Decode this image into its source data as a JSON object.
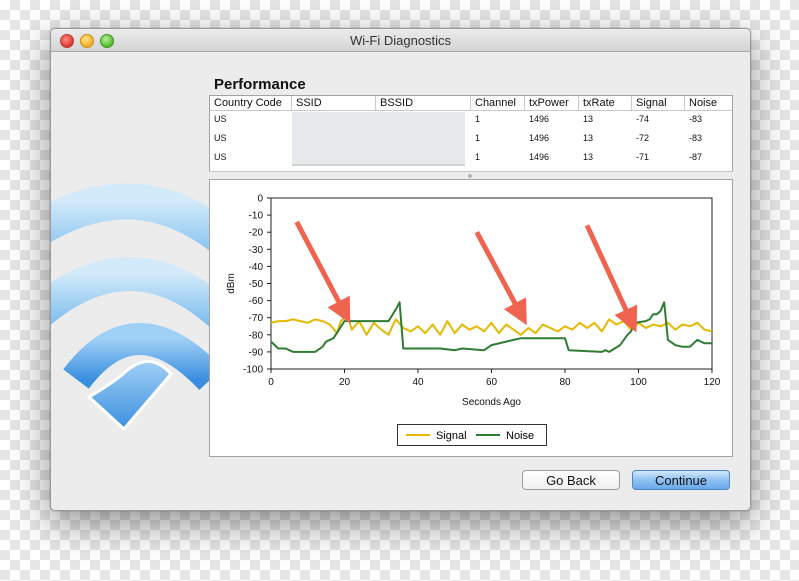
{
  "window": {
    "title": "Wi-Fi Diagnostics"
  },
  "performance": {
    "heading": "Performance",
    "columns": [
      "Country Code",
      "SSID",
      "BSSID",
      "Channel",
      "txPower",
      "txRate",
      "Signal",
      "Noise"
    ],
    "rows": [
      {
        "country": "US",
        "channel": "1",
        "txpower": "1496",
        "txrate": "13",
        "signal": "-74",
        "noise": "-83"
      },
      {
        "country": "US",
        "channel": "1",
        "txpower": "1496",
        "txrate": "13",
        "signal": "-72",
        "noise": "-83"
      },
      {
        "country": "US",
        "channel": "1",
        "txpower": "1496",
        "txrate": "13",
        "signal": "-71",
        "noise": "-87"
      }
    ]
  },
  "chart_data": {
    "type": "line",
    "xlabel": "Seconds Ago",
    "ylabel": "dBm",
    "xlim": [
      0,
      120
    ],
    "ylim": [
      -100,
      0
    ],
    "xticks": [
      0,
      20,
      40,
      60,
      80,
      100,
      120
    ],
    "yticks": [
      0,
      -10,
      -20,
      -30,
      -40,
      -50,
      -60,
      -70,
      -80,
      -90,
      -100
    ],
    "legend_position": "bottom-center",
    "series": [
      {
        "name": "Signal",
        "color": "#e6b800",
        "points": [
          [
            0,
            -73
          ],
          [
            2,
            -72
          ],
          [
            4,
            -72
          ],
          [
            6,
            -71
          ],
          [
            8,
            -72
          ],
          [
            10,
            -73
          ],
          [
            12,
            -71
          ],
          [
            14,
            -72
          ],
          [
            16,
            -74
          ],
          [
            18,
            -79
          ],
          [
            19,
            -72
          ],
          [
            20,
            -70
          ],
          [
            21,
            -70
          ],
          [
            22,
            -77
          ],
          [
            24,
            -72
          ],
          [
            26,
            -80
          ],
          [
            28,
            -73
          ],
          [
            30,
            -77
          ],
          [
            32,
            -80
          ],
          [
            33,
            -75
          ],
          [
            34,
            -71
          ],
          [
            36,
            -76
          ],
          [
            38,
            -78
          ],
          [
            40,
            -75
          ],
          [
            42,
            -79
          ],
          [
            44,
            -74
          ],
          [
            46,
            -80
          ],
          [
            48,
            -72
          ],
          [
            50,
            -79
          ],
          [
            52,
            -74
          ],
          [
            54,
            -77
          ],
          [
            56,
            -75
          ],
          [
            58,
            -78
          ],
          [
            60,
            -73
          ],
          [
            62,
            -79
          ],
          [
            64,
            -74
          ],
          [
            66,
            -77
          ],
          [
            68,
            -80
          ],
          [
            70,
            -76
          ],
          [
            72,
            -79
          ],
          [
            74,
            -74
          ],
          [
            76,
            -76
          ],
          [
            78,
            -78
          ],
          [
            80,
            -75
          ],
          [
            82,
            -77
          ],
          [
            84,
            -73
          ],
          [
            86,
            -76
          ],
          [
            88,
            -73
          ],
          [
            90,
            -78
          ],
          [
            92,
            -71
          ],
          [
            94,
            -74
          ],
          [
            96,
            -72
          ],
          [
            98,
            -77
          ],
          [
            100,
            -73
          ],
          [
            102,
            -76
          ],
          [
            104,
            -74
          ],
          [
            106,
            -75
          ],
          [
            108,
            -73
          ],
          [
            110,
            -77
          ],
          [
            112,
            -74
          ],
          [
            114,
            -75
          ],
          [
            116,
            -73
          ],
          [
            118,
            -77
          ],
          [
            120,
            -78
          ]
        ]
      },
      {
        "name": "Noise",
        "color": "#2e7d32",
        "points": [
          [
            0,
            -84
          ],
          [
            2,
            -88
          ],
          [
            4,
            -88
          ],
          [
            6,
            -90
          ],
          [
            8,
            -90
          ],
          [
            10,
            -90
          ],
          [
            12,
            -90
          ],
          [
            14,
            -87
          ],
          [
            15,
            -84
          ],
          [
            17,
            -82
          ],
          [
            20,
            -72
          ],
          [
            30,
            -72
          ],
          [
            32,
            -72
          ],
          [
            34,
            -65
          ],
          [
            35,
            -61
          ],
          [
            36,
            -88
          ],
          [
            40,
            -88
          ],
          [
            46,
            -88
          ],
          [
            50,
            -89
          ],
          [
            52,
            -88
          ],
          [
            58,
            -89
          ],
          [
            60,
            -86
          ],
          [
            64,
            -84
          ],
          [
            68,
            -82
          ],
          [
            80,
            -82
          ],
          [
            81,
            -89
          ],
          [
            90,
            -90
          ],
          [
            91,
            -89
          ],
          [
            92,
            -90
          ],
          [
            95,
            -86
          ],
          [
            97,
            -80
          ],
          [
            98,
            -78
          ],
          [
            99,
            -73
          ],
          [
            102,
            -72
          ],
          [
            103,
            -71
          ],
          [
            104,
            -68
          ],
          [
            105,
            -68
          ],
          [
            106,
            -66
          ],
          [
            107,
            -61
          ],
          [
            108,
            -83
          ],
          [
            110,
            -86
          ],
          [
            112,
            -87
          ],
          [
            114,
            -87
          ],
          [
            116,
            -83
          ],
          [
            118,
            -85
          ],
          [
            120,
            -85
          ]
        ]
      }
    ]
  },
  "annotations": [
    {
      "name": "arrow-1",
      "from": [
        7,
        -14
      ],
      "to": [
        20,
        -67
      ]
    },
    {
      "name": "arrow-2",
      "from": [
        56,
        -20
      ],
      "to": [
        68,
        -68
      ]
    },
    {
      "name": "arrow-3",
      "from": [
        86,
        -16
      ],
      "to": [
        98,
        -72
      ]
    }
  ],
  "buttons": {
    "back": "Go Back",
    "continue": "Continue"
  }
}
